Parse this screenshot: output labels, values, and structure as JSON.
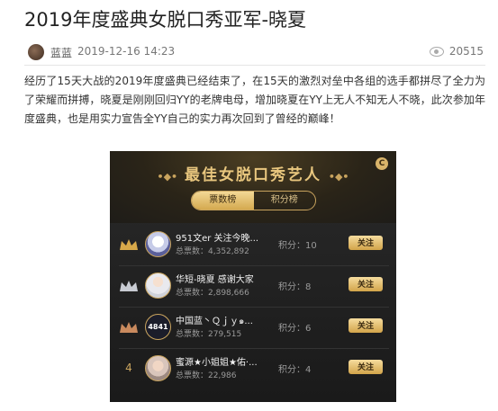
{
  "article": {
    "title": "2019年度盛典女脱口秀亚军-晓夏",
    "author": "蓝蓝",
    "date": "2019-12-16 14:23",
    "views": "20515",
    "body": "经历了15天大战的2019年度盛典已经结束了，在15天的激烈对垒中各组的选手都拼尽了全力为了荣耀而拼搏，晓夏是刚刚回归YY的老牌电母，增加晓夏在YY上无人不知无人不晓，此次参加年度盛典，也是用实力宣告全YY自己的实力再次回到了曾经的巅峰！"
  },
  "card": {
    "title": "最佳女脱口秀艺人",
    "badge": "C",
    "tabs": [
      {
        "label": "票数榜",
        "active": true
      },
      {
        "label": "积分榜",
        "active": false
      }
    ],
    "rows": [
      {
        "rank": "1",
        "name": "951文er 关注今晚...",
        "votes": "总票数：4,352,892",
        "score": "积分：10",
        "follow": "关注",
        "avatar": "",
        "crown_color": "#d8a94a"
      },
      {
        "rank": "2",
        "name": "华短-晓夏 感谢大家",
        "votes": "总票数：2,898,666",
        "score": "积分：8",
        "follow": "关注",
        "avatar": "",
        "crown_color": "#c9ccd3"
      },
      {
        "rank": "3",
        "name": "中国蓝丶Ｑｊｙ๑...",
        "votes": "总票数：279,515",
        "score": "积分：6",
        "follow": "关注",
        "avatar": "4841",
        "crown_color": "#c98a5e"
      },
      {
        "rank": "4",
        "name": "蜜源★小姐姐★佑·...",
        "votes": "总票数：22,986",
        "score": "积分：4",
        "follow": "关注",
        "avatar": "",
        "crown_color": ""
      }
    ]
  },
  "icons": {
    "views": "eye-icon",
    "author": "author-avatar",
    "crown": "crown-icon",
    "badge": "c-badge-icon"
  },
  "colors": {
    "gold": "#c9a45e",
    "card_bg": "#1e1e1e"
  }
}
